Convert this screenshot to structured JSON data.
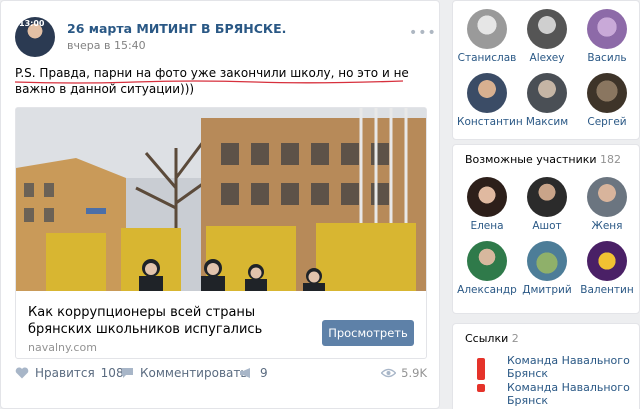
{
  "post": {
    "avatar_badge": "13:00",
    "author": "26 марта МИТИНГ В БРЯНСКЕ.",
    "date": "вчера в 15:40",
    "more": "•••",
    "text": "P.S. Правда, парни на фото уже закончили школу, но это и не важно в данной ситуации)))",
    "attachment": {
      "title": "Как коррупционеры всей страны брянских школьников испугались",
      "source": "navalny.com",
      "button": "Просмотреть"
    },
    "actions": {
      "like_label": "Нравится",
      "like_count": "108",
      "comment_label": "Комментировать",
      "share_count": "9",
      "views": "5.9K"
    },
    "colors": {
      "link": "#2a5885",
      "button": "#5e81a8",
      "underline": "#d7303d"
    }
  },
  "friends": [
    {
      "name": "Станислав",
      "icon": "avatar-stanislav"
    },
    {
      "name": "Alexey",
      "icon": "avatar-alexey"
    },
    {
      "name": "Василь",
      "icon": "avatar-vasil-cat"
    },
    {
      "name": "Константин",
      "icon": "avatar-konstantin"
    },
    {
      "name": "Максим",
      "icon": "avatar-maksim"
    },
    {
      "name": "Сергей",
      "icon": "avatar-sergey"
    }
  ],
  "members": {
    "title": "Возможные участники",
    "count": "182",
    "items": [
      {
        "name": "Елена",
        "icon": "avatar-elena"
      },
      {
        "name": "Ашот",
        "icon": "avatar-ashot"
      },
      {
        "name": "Женя",
        "icon": "avatar-zhenya"
      },
      {
        "name": "Александр",
        "icon": "avatar-aleksandr"
      },
      {
        "name": "Дмитрий",
        "icon": "avatar-dmitriy"
      },
      {
        "name": "Валентин",
        "icon": "avatar-valentin"
      }
    ]
  },
  "links": {
    "title": "Ссылки",
    "count": "2",
    "items": [
      {
        "text": "Команда Навального Брянск",
        "sub": "Команда Навального Брянск"
      }
    ]
  }
}
